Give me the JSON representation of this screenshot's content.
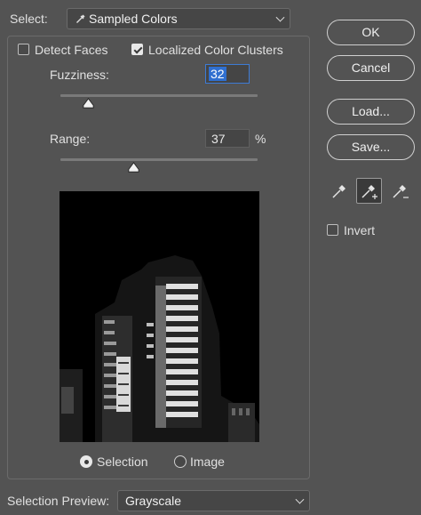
{
  "select": {
    "label": "Select:",
    "value": "Sampled Colors"
  },
  "options": {
    "detect_faces": {
      "label": "Detect Faces",
      "checked": false
    },
    "localized_clusters": {
      "label": "Localized Color Clusters",
      "checked": true
    }
  },
  "fuzziness": {
    "label": "Fuzziness:",
    "value": "32",
    "slider_fraction": 0.14
  },
  "range": {
    "label": "Range:",
    "value": "37",
    "unit": "%",
    "slider_fraction": 0.37
  },
  "buttons": {
    "ok": "OK",
    "cancel": "Cancel",
    "load": "Load...",
    "save": "Save..."
  },
  "tools": [
    "eyedropper-icon",
    "eyedropper-plus-icon",
    "eyedropper-minus-icon"
  ],
  "invert": {
    "label": "Invert",
    "checked": false
  },
  "preview_mode": {
    "selection_label": "Selection",
    "image_label": "Image",
    "selected": "selection"
  },
  "selection_preview": {
    "label": "Selection Preview:",
    "value": "Grayscale"
  }
}
